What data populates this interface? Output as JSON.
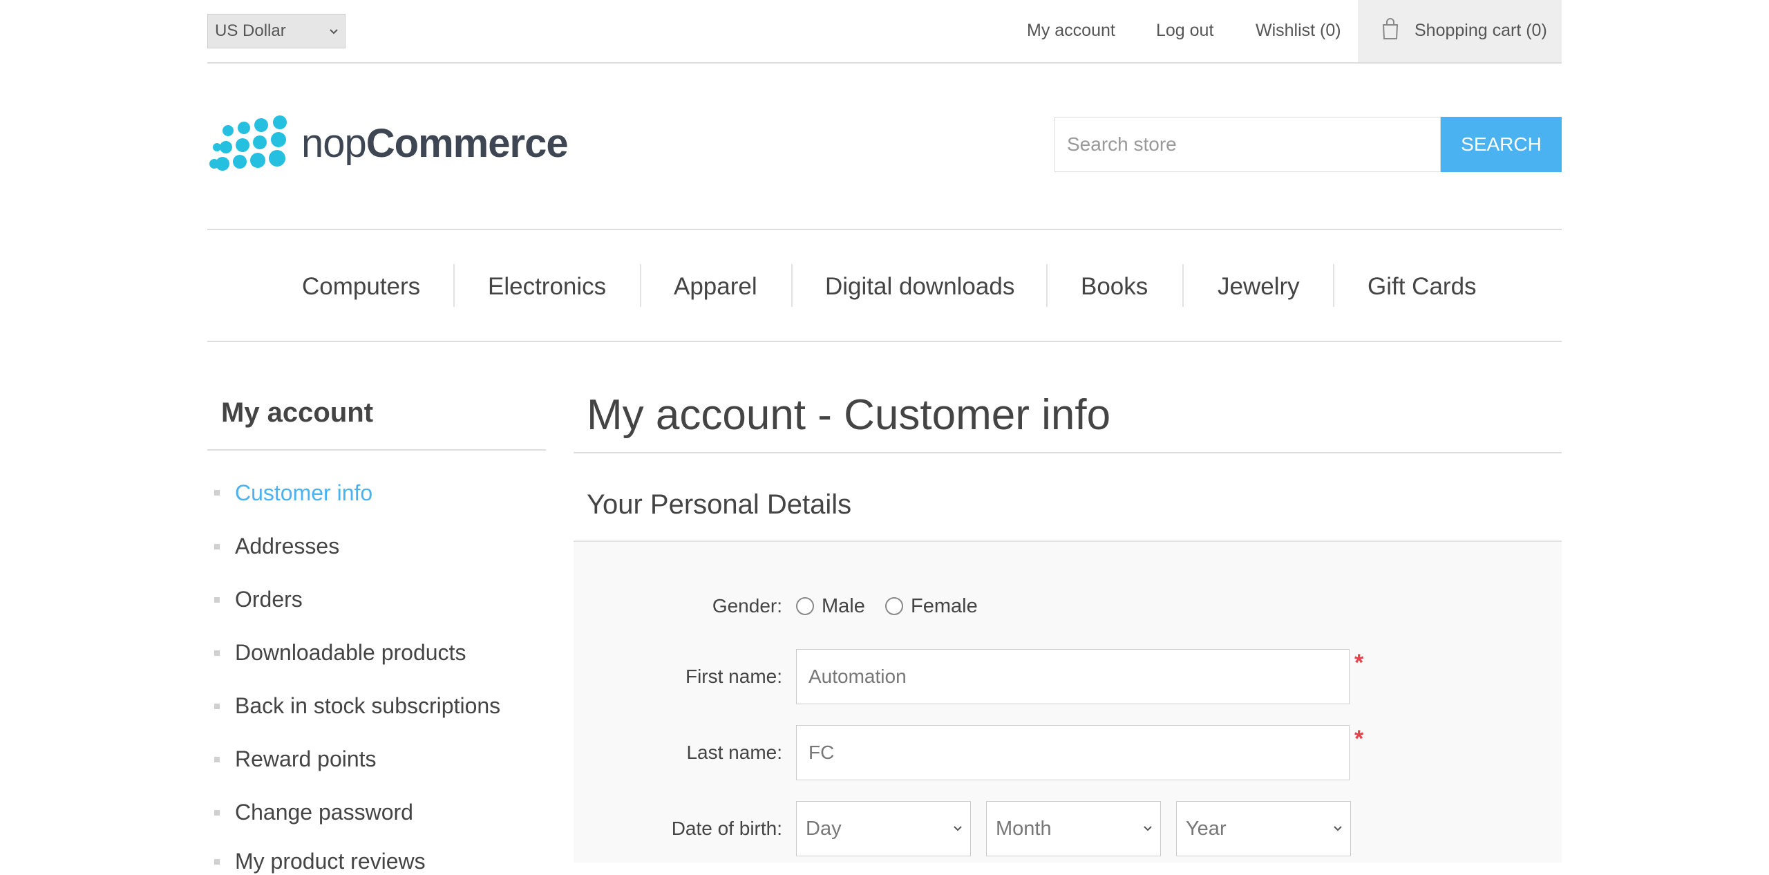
{
  "header": {
    "currency": "US Dollar",
    "links": {
      "my_account": "My account",
      "log_out": "Log out",
      "wishlist": "Wishlist (0)",
      "cart": "Shopping cart (0)"
    }
  },
  "logo": {
    "part1": "nop",
    "part2": "Commerce"
  },
  "search": {
    "placeholder": "Search store",
    "button": "Search"
  },
  "menu": {
    "items": [
      "Computers",
      "Electronics",
      "Apparel",
      "Digital downloads",
      "Books",
      "Jewelry",
      "Gift Cards"
    ]
  },
  "sidebar": {
    "title": "My account",
    "items": [
      "Customer info",
      "Addresses",
      "Orders",
      "Downloadable products",
      "Back in stock subscriptions",
      "Reward points",
      "Change password",
      "My product reviews"
    ],
    "active_index": 0
  },
  "main": {
    "title": "My account - Customer info",
    "section_title": "Your Personal Details",
    "form": {
      "gender_label": "Gender:",
      "gender_male": "Male",
      "gender_female": "Female",
      "first_name_label": "First name:",
      "first_name_value": "Automation",
      "last_name_label": "Last name:",
      "last_name_value": "FC",
      "dob_label": "Date of birth:",
      "dob_day": "Day",
      "dob_month": "Month",
      "dob_year": "Year",
      "required_marker": "*"
    }
  },
  "colors": {
    "accent": "#4ab2f1",
    "required": "#e4434b",
    "text": "#444444",
    "border": "#dddddd"
  },
  "icons": [
    "chevron-down-icon",
    "shopping-bag-icon",
    "nopcommerce-logo-icon"
  ]
}
